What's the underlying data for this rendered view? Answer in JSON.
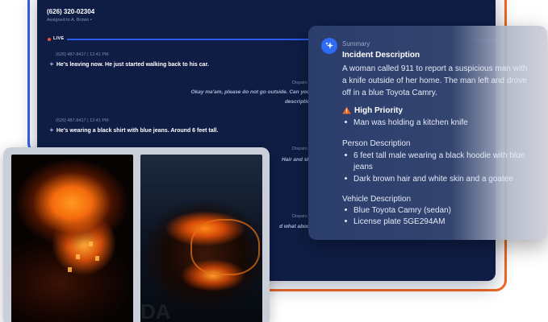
{
  "call": {
    "phone": "(626) 320-02304",
    "assigned": "Assigned to A. Brown •",
    "live_label": "LIVE",
    "messages": [
      {
        "meta": "(626) 487-8417 | 12:41 PM",
        "text": "He's leaving now. He just started walking back to his car."
      },
      {
        "label": "Dispato",
        "text_line1": "Okay ma'am, please do not go outside. Can you",
        "text_line2": "descriptio"
      },
      {
        "meta": "(626) 487-8417 | 12:41 PM",
        "text": "He's wearing a black shirt with blue jeans. Around 6 feet tall."
      },
      {
        "label": "Dispato",
        "text_line1": "Hair and sk"
      },
      {
        "label": "Dispato",
        "text_line1": "d what abou"
      }
    ]
  },
  "photos": {
    "watermark": "DA"
  },
  "summary": {
    "header": "Summary",
    "incident_title": "Incident Description",
    "incident_lines": [
      "A woman called 911 to report a suspicious man with",
      "a knife outside of her home. The man left and drove",
      "off in a blue Toyota Camry."
    ],
    "priority_title": "High Priority",
    "priority_items": [
      "Man was holding a kitchen knife"
    ],
    "person_title": "Person Description",
    "person_items": [
      {
        "line1": "6 feet tall male wearing a black hoodie with blue",
        "line2": "jeans"
      },
      {
        "line1": "Dark brown hair and white skin and a goatee"
      }
    ],
    "vehicle_title": "Vehicle Description",
    "vehicle_items": [
      "Blue Toyota Camry (sedan)",
      "License plate 5GE294AM"
    ],
    "accent_color": "#2e6bf5",
    "warning_color": "#f06a23"
  }
}
